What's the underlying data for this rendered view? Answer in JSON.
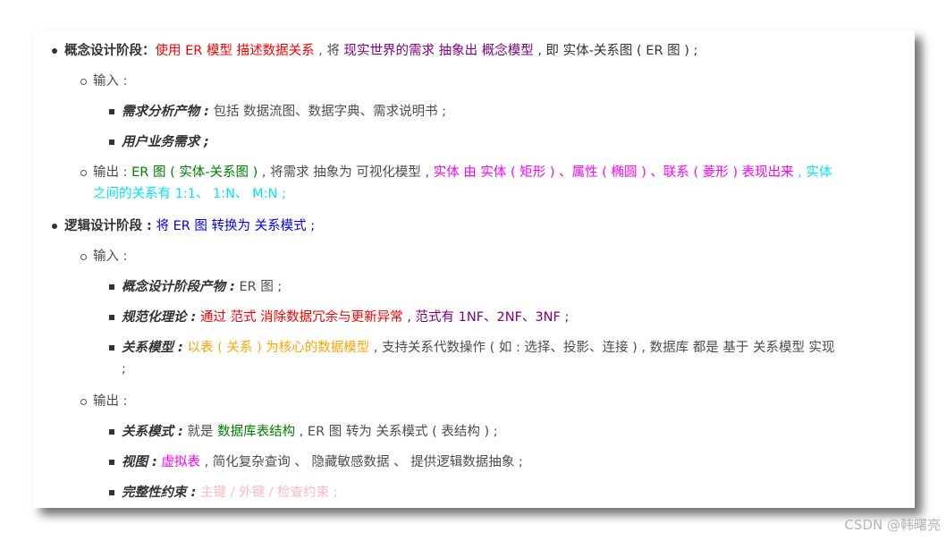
{
  "items": {
    "l1": {
      "title": "概念设计阶段：",
      "t1": "使用 ER 模型 描述数据关系",
      "t2": " , 将 ",
      "t3": "现实世界的需求 抽象出 概念模型",
      "t4": " , 即 实体-关系图 ( ER 图 ) ;"
    },
    "l2": {
      "text": "输入 :"
    },
    "l3": {
      "title": "需求分析产物 :",
      "text": " 包括 数据流图、数据字典、需求说明书 ;"
    },
    "l4": {
      "title": "用户业务需求 ;"
    },
    "l5": {
      "t1": "输出 : ",
      "t2": "ER 图 ( 实体-关系图 )",
      "t3": " , 将需求 抽象为 可视化模型 , ",
      "t4": "实体 由 实体 ( 矩形 ) 、属性 ( 椭圆 ) 、联系 ( 菱形 ) 表现出来",
      "t5": " , ",
      "t6": "实体"
    },
    "l5b": {
      "text": "之间的关系有 1:1、 1:N、 M:N ;"
    },
    "l6": {
      "title": "逻辑设计阶段 :",
      "t1": " 将 ER 图 转换为 关系模式",
      "t2": " ;"
    },
    "l7": {
      "text": "输入 :"
    },
    "l8": {
      "title": "概念设计阶段产物 :",
      "text": " ER 图 ;"
    },
    "l9": {
      "title": "规范化理论 :",
      "t1": " 通过 范式 消除数据冗余与更新异常",
      "t2": " , 范式有 1NF、2NF、3NF ;"
    },
    "l10": {
      "title": "关系模型 :",
      "t1": " 以表 ( 关系 ) 为核心的数据模型",
      "t2": " , 支持关系代数操作 ( 如 : 选择、投影、连接 ) , 数据库 都是 基于 关系模型 实现"
    },
    "l10b": {
      "text": ";"
    },
    "l11": {
      "text": "输出 :"
    },
    "l12": {
      "title": "关系模式 :",
      "t1": " 就是 ",
      "t2": "数据库表结构",
      "t3": " , ER 图 转为 关系模式 ( 表结构 ) ;"
    },
    "l13": {
      "title": "视图 :",
      "t1": " 虚拟表",
      "t2": " , 简化复杂查询 、 隐藏敏感数据 、 提供逻辑数据抽象 ;"
    },
    "l14": {
      "title": "完整性约束 :",
      "t1": " 主键 / 外键 / 检查约束 ;"
    }
  },
  "watermark": "CSDN @韩曙亮",
  "colors": {
    "red": "#ff0000",
    "purple": "#800080",
    "green": "#008000",
    "magenta": "#ff00ff",
    "cyan": "#00e5ee",
    "blue": "#0000ff",
    "orange": "#ffa500",
    "pink": "#ffb6c1"
  }
}
